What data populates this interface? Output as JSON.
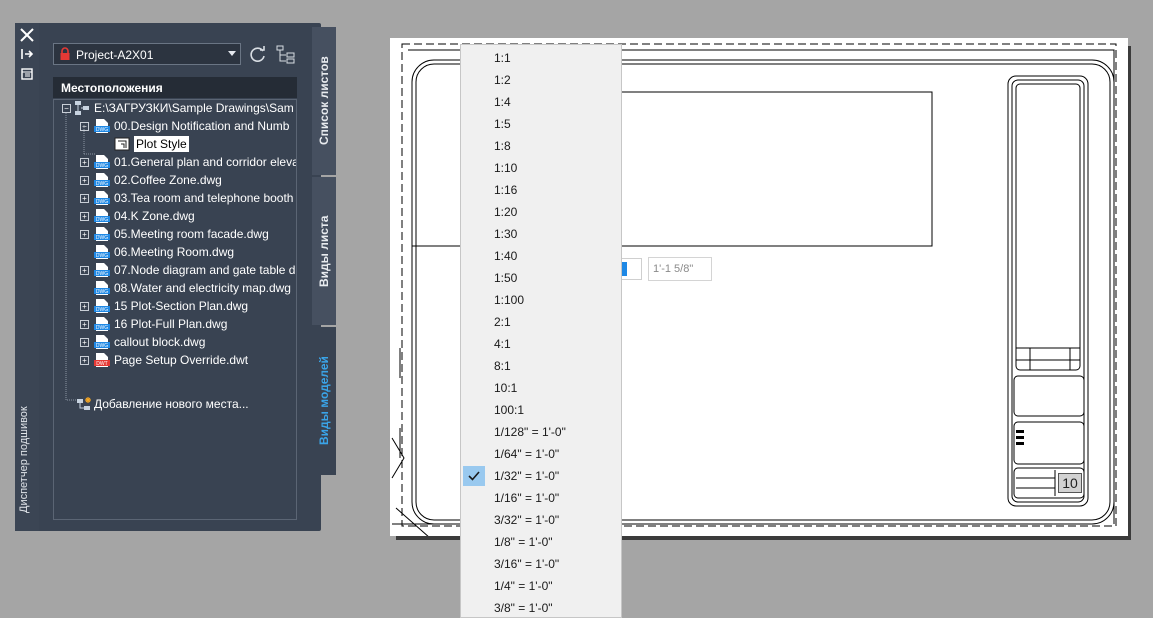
{
  "palette": {
    "title": "Диспетчер подшивок",
    "project": "Project-A2X01",
    "locations_header": "Местоположения",
    "tabs": [
      {
        "label": "Список листов",
        "active": false
      },
      {
        "label": "Виды листа",
        "active": false
      },
      {
        "label": "Виды моделей",
        "active": true
      }
    ],
    "tree": {
      "root": "E:\\ЗАГРУЗКИ\\Sample Drawings\\Sam",
      "items": [
        {
          "label": "00.Design Notification and Numb",
          "expander": "−",
          "icon": "dwg-icon"
        },
        {
          "label": "Plot Style",
          "icon": "layout-icon",
          "selected": true
        },
        {
          "label": "01.General plan and corridor eleva",
          "expander": "+",
          "icon": "dwg-icon"
        },
        {
          "label": "02.Coffee Zone.dwg",
          "expander": "+",
          "icon": "dwg-icon"
        },
        {
          "label": "03.Tea room and telephone booth",
          "expander": "+",
          "icon": "dwg-icon"
        },
        {
          "label": "04.K Zone.dwg",
          "expander": "+",
          "icon": "dwg-icon"
        },
        {
          "label": "05.Meeting room facade.dwg",
          "expander": "+",
          "icon": "dwg-icon"
        },
        {
          "label": "06.Meeting Room.dwg",
          "expander": "",
          "icon": "dwg-icon"
        },
        {
          "label": "07.Node diagram and gate table d",
          "expander": "+",
          "icon": "dwg-icon"
        },
        {
          "label": "08.Water and electricity map.dwg",
          "expander": "",
          "icon": "dwg-icon"
        },
        {
          "label": "15 Plot-Section Plan.dwg",
          "expander": "+",
          "icon": "dwg-icon"
        },
        {
          "label": "16 Plot-Full Plan.dwg",
          "expander": "+",
          "icon": "dwg-icon"
        },
        {
          "label": "callout block.dwg",
          "expander": "+",
          "icon": "dwg-icon"
        },
        {
          "label": "Page Setup Override.dwt",
          "expander": "+",
          "icon": "dwt-icon"
        }
      ],
      "add_location": "Добавление нового места..."
    }
  },
  "viewport": {
    "scale_field": "1'-1 5/8\"",
    "title_block_number": "10"
  },
  "scale_list": {
    "selected": "1/32\" = 1'-0\"",
    "items": [
      "1:1",
      "1:2",
      "1:4",
      "1:5",
      "1:8",
      "1:10",
      "1:16",
      "1:20",
      "1:30",
      "1:40",
      "1:50",
      "1:100",
      "2:1",
      "4:1",
      "8:1",
      "10:1",
      "100:1",
      "1/128\" = 1'-0\"",
      "1/64\" = 1'-0\"",
      "1/32\" = 1'-0\"",
      "1/16\" = 1'-0\"",
      "3/32\" = 1'-0\"",
      "1/8\" = 1'-0\"",
      "3/16\" = 1'-0\"",
      "1/4\" = 1'-0\"",
      "3/8\" = 1'-0\""
    ]
  },
  "colors": {
    "palette_bg": "#394352",
    "active_tab_text": "#3aa4e8",
    "checked_bg": "#99c9ef",
    "canvas_bg": "#a5a5a5"
  }
}
